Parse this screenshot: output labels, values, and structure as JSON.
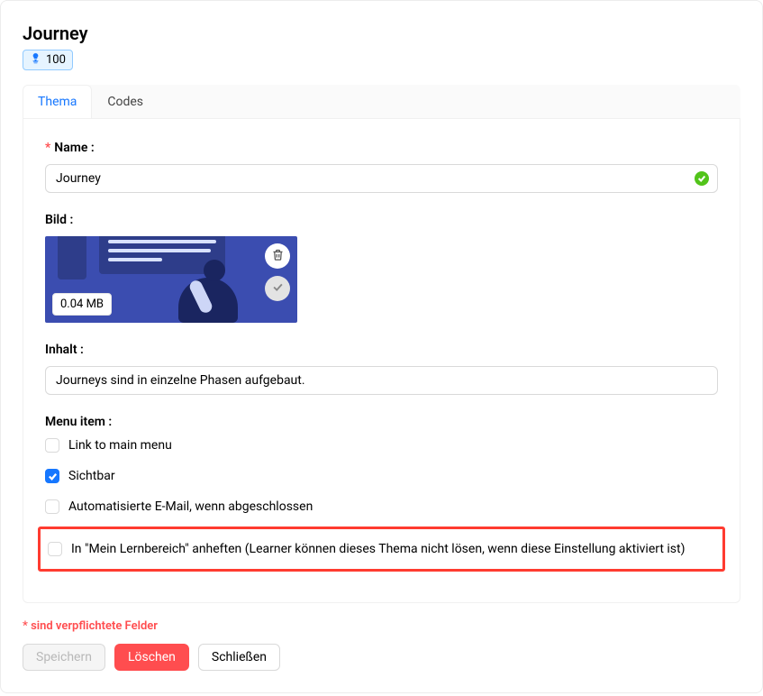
{
  "header": {
    "title": "Journey",
    "badge_value": "100"
  },
  "tabs": {
    "thema_label": "Thema",
    "codes_label": "Codes"
  },
  "form": {
    "name_label": "Name :",
    "name_value": "Journey",
    "bild_label": "Bild :",
    "image_size": "0.04 MB",
    "inhalt_label": "Inhalt :",
    "inhalt_value": "Journeys sind in einzelne Phasen aufgebaut.",
    "menu_item_label": "Menu item :",
    "checkboxes": {
      "link_main_menu": "Link to main menu",
      "sichtbar": "Sichtbar",
      "auto_email": "Automatisierte E-Mail, wenn abgeschlossen",
      "anheften": "In \"Mein Lernbereich\" anheften (Learner können dieses Thema nicht lösen, wenn diese Einstellung aktiviert ist)"
    }
  },
  "footer": {
    "required_note": "* sind verpflichtete Felder",
    "speichern": "Speichern",
    "loeschen": "Löschen",
    "schliessen": "Schließen"
  }
}
